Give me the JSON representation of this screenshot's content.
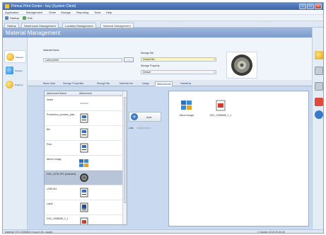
{
  "window": {
    "title": "Primus Print Center - key (System Client)",
    "controls": {
      "minimize": "–",
      "maximize": "□",
      "close": "×"
    }
  },
  "menu": [
    "Application",
    "Management",
    "Order",
    "Storage",
    "Reporting",
    "Tools",
    "Help"
  ],
  "toolbar": {
    "startup_label": "Startup",
    "exit_label": "Exit"
  },
  "doc_tabs": [
    "Startup",
    "Warehouse Management",
    "Location Management",
    "Material Management"
  ],
  "heading": "Material Management",
  "left_nav": [
    "Material",
    "Storage",
    "Property"
  ],
  "form": {
    "material_name_label": "Material Name",
    "material_name_value": "Label printer",
    "browse_label": "...",
    "storage_bin_label": "Storage Bin",
    "storage_bin_value": "Default Bin",
    "storage_property_label": "Storage Property",
    "storage_property_value": "Default"
  },
  "tabs": [
    "Basic Data",
    "Storage Properties",
    "Storage Bin",
    "Material Info",
    "Usage",
    "Attachments",
    "Variations"
  ],
  "active_tab_index": 5,
  "grid": {
    "columns": [
      "Attachment Name",
      "Attachment"
    ],
    "rows": [
      {
        "name": "Notes",
        "icon": "text-icon"
      },
      {
        "name": "Production_process_plan",
        "icon": "document-icon"
      },
      {
        "name": "Bill",
        "icon": "document-icon"
      },
      {
        "name": "Print",
        "icon": "document-icon"
      },
      {
        "name": "Album Image",
        "icon": "album-icon"
      },
      {
        "name": "DSC_0278.JPG (selected)",
        "icon": "photo-icon"
      },
      {
        "name": "USB-003",
        "icon": "document-icon"
      },
      {
        "name": "Label",
        "icon": "document-icon"
      },
      {
        "name": "DSC_0058658_1_1",
        "icon": "pdf-icon"
      }
    ],
    "selected_index": 5
  },
  "middle": {
    "add_label": "Add",
    "link_label": "Link",
    "link_value": "Attachments"
  },
  "preview_tiles": [
    {
      "label": "Album Image",
      "icon": "album-icon"
    },
    {
      "label": "DSC_0058658_1_1",
      "icon": "pdf-icon"
    }
  ],
  "status": {
    "left": "Material: STO-0093820 (record) Ok, loaded",
    "right": "1 October 2015 09:33:43"
  },
  "colors": {
    "accent": "#3d66a8",
    "heading": "#8aa5d4",
    "selected_row": "#b8c4d8",
    "field_highlight": "#fbf7c0"
  }
}
